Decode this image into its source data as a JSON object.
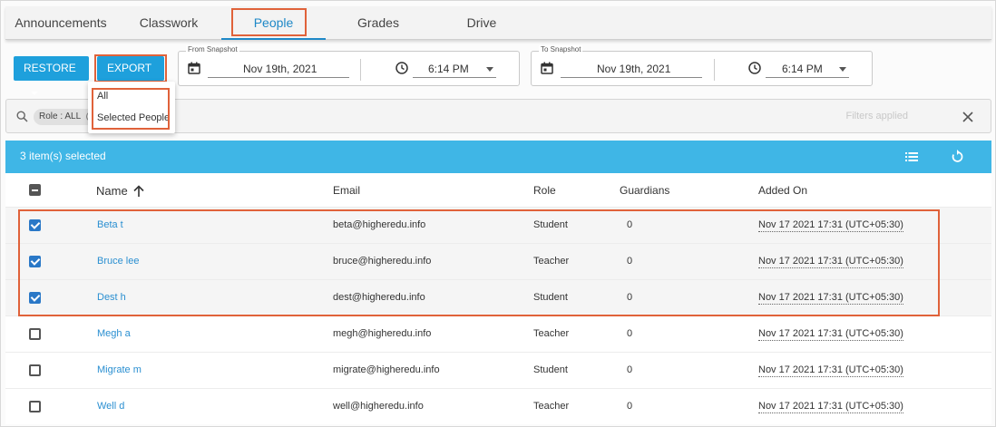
{
  "tabs": [
    {
      "label": "Announcements"
    },
    {
      "label": "Classwork"
    },
    {
      "label": "People"
    },
    {
      "label": "Grades"
    },
    {
      "label": "Drive"
    }
  ],
  "active_tab": "People",
  "toolbar": {
    "restore_label": "RESTORE",
    "export_label": "EXPORT"
  },
  "export_menu": {
    "items": [
      {
        "label": "All"
      },
      {
        "label": "Selected People"
      }
    ]
  },
  "from_snapshot": {
    "legend": "From Snapshot",
    "date": "Nov 19th, 2021",
    "time": "6:14 PM"
  },
  "to_snapshot": {
    "legend": "To Snapshot",
    "date": "Nov 19th, 2021",
    "time": "6:14 PM"
  },
  "filters": {
    "chip_label": "Role : ALL",
    "applied_text": "Filters applied"
  },
  "selection": {
    "text": "3 item(s) selected"
  },
  "table": {
    "headers": {
      "name": "Name",
      "email": "Email",
      "role": "Role",
      "guardians": "Guardians",
      "added_on": "Added On"
    },
    "rows": [
      {
        "name": "Beta t",
        "email": "beta@higheredu.info",
        "role": "Student",
        "guardians": "0",
        "added_on": "Nov 17 2021 17:31 (UTC+05:30)",
        "selected": true
      },
      {
        "name": "Bruce lee",
        "email": "bruce@higheredu.info",
        "role": "Teacher",
        "guardians": "0",
        "added_on": "Nov 17 2021 17:31 (UTC+05:30)",
        "selected": true
      },
      {
        "name": "Dest h",
        "email": "dest@higheredu.info",
        "role": "Student",
        "guardians": "0",
        "added_on": "Nov 17 2021 17:31 (UTC+05:30)",
        "selected": true
      },
      {
        "name": "Megh a",
        "email": "megh@higheredu.info",
        "role": "Teacher",
        "guardians": "0",
        "added_on": "Nov 17 2021 17:31 (UTC+05:30)",
        "selected": false
      },
      {
        "name": "Migrate m",
        "email": "migrate@higheredu.info",
        "role": "Student",
        "guardians": "0",
        "added_on": "Nov 17 2021 17:31 (UTC+05:30)",
        "selected": false
      },
      {
        "name": "Well d",
        "email": "well@higheredu.info",
        "role": "Teacher",
        "guardians": "0",
        "added_on": "Nov 17 2021 17:31 (UTC+05:30)",
        "selected": false
      }
    ]
  },
  "colors": {
    "accent": "#1ea0dc",
    "selection_bar": "#3fb6e6",
    "highlight": "#e0623a",
    "link": "#2a8fd1"
  },
  "icons": {
    "calendar": "calendar-icon",
    "clock": "clock-icon",
    "search": "search-icon",
    "close": "close-icon",
    "list": "list-view-icon",
    "refresh": "refresh-icon",
    "sort": "arrow-up-icon"
  }
}
